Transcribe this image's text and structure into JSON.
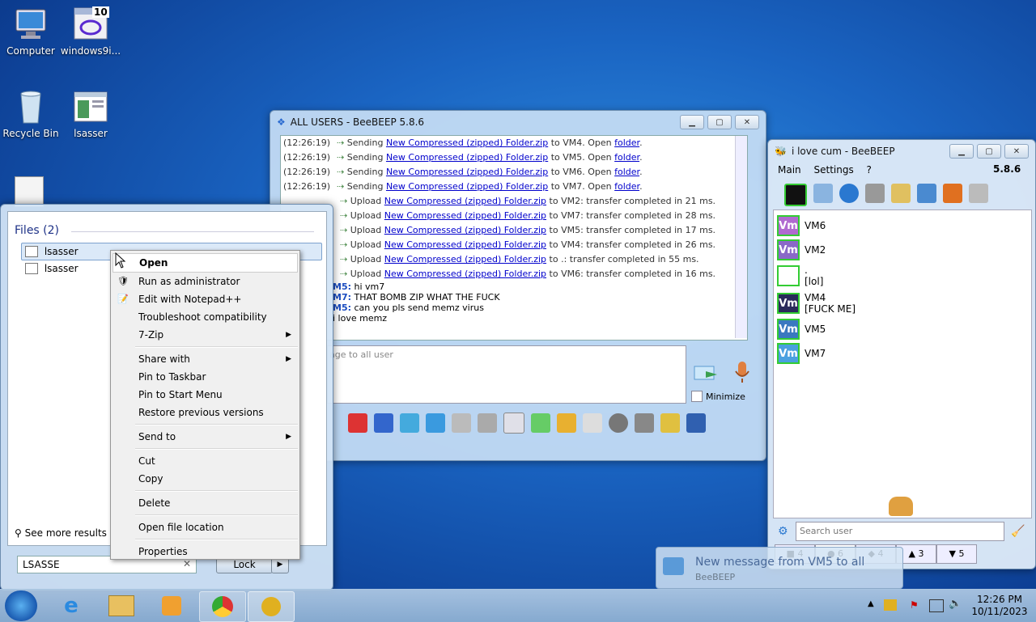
{
  "desktop": {
    "icons": [
      {
        "label": "Computer"
      },
      {
        "label": "windows9i..."
      },
      {
        "label": "Recycle Bin"
      },
      {
        "label": "lsasser"
      }
    ],
    "badge_10": "10"
  },
  "main_window": {
    "title": "ALL USERS - BeeBEEP 5.8.6",
    "log": [
      {
        "time": "(12:26:19)",
        "pre": "Sending ",
        "file": "New Compressed (zipped) Folder.zip",
        "mid": " to VM4. Open ",
        "link": "folder",
        "post": "."
      },
      {
        "time": "(12:26:19)",
        "pre": "Sending ",
        "file": "New Compressed (zipped) Folder.zip",
        "mid": " to VM5. Open ",
        "link": "folder",
        "post": "."
      },
      {
        "time": "(12:26:19)",
        "pre": "Sending ",
        "file": "New Compressed (zipped) Folder.zip",
        "mid": " to VM6. Open ",
        "link": "folder",
        "post": "."
      },
      {
        "time": "(12:26:19)",
        "pre": "Sending ",
        "file": "New Compressed (zipped) Folder.zip",
        "mid": " to VM7. Open ",
        "link": "folder",
        "post": "."
      },
      {
        "time": "",
        "pre": "Upload ",
        "file": "New Compressed (zipped) Folder.zip",
        "mid": " to VM2: transfer completed in 21 ms.",
        "link": "",
        "post": ""
      },
      {
        "time": "",
        "pre": "Upload ",
        "file": "New Compressed (zipped) Folder.zip",
        "mid": " to VM7: transfer completed in 28 ms.",
        "link": "",
        "post": ""
      },
      {
        "time": "",
        "pre": "Upload ",
        "file": "New Compressed (zipped) Folder.zip",
        "mid": " to VM5: transfer completed in 17 ms.",
        "link": "",
        "post": ""
      },
      {
        "time": "",
        "pre": "Upload ",
        "file": "New Compressed (zipped) Folder.zip",
        "mid": " to VM4: transfer completed in 26 ms.",
        "link": "",
        "post": ""
      },
      {
        "time": "",
        "pre": "Upload ",
        "file": "New Compressed (zipped) Folder.zip",
        "mid": " to .: transfer completed in 55 ms.",
        "link": "",
        "post": ""
      },
      {
        "time": "",
        "pre": "Upload ",
        "file": "New Compressed (zipped) Folder.zip",
        "mid": " to VM6: transfer completed in 16 ms.",
        "link": "",
        "post": ""
      }
    ],
    "chat": [
      {
        "who": "M5:",
        "msg": " hi vm7"
      },
      {
        "who": "M7:",
        "msg": " THAT BOMB ZIP WHAT THE FUCK"
      },
      {
        "who": "M5:",
        "msg": " can you pls send memz virus"
      },
      {
        "who": "",
        "msg": "i love memz"
      }
    ],
    "input_placeholder": "age to all user",
    "minimize_label": "Minimize"
  },
  "right_window": {
    "title": "i love cum - BeeBEEP",
    "menu": [
      "Main",
      "Settings",
      "?"
    ],
    "version": "5.8.6",
    "users": [
      {
        "avatar": "Vm",
        "name": "VM6",
        "status": "",
        "color": "#b06ad0"
      },
      {
        "avatar": "Vm",
        "name": "VM2",
        "status": "",
        "color": "#8a68c8"
      },
      {
        "avatar": "",
        "name": ".",
        "status": "[lol]",
        "color": "#ffffff"
      },
      {
        "avatar": "Vm",
        "name": "VM4",
        "status": "[FUCK ME]",
        "color": "#2a2a5a"
      },
      {
        "avatar": "Vm",
        "name": "VM5",
        "status": "",
        "color": "#3a78c0"
      },
      {
        "avatar": "Vm",
        "name": "VM7",
        "status": "",
        "color": "#4aa0e0"
      }
    ],
    "search_placeholder": "Search user",
    "tabs": [
      "4",
      "6",
      "4",
      "3",
      "5"
    ]
  },
  "notification": {
    "title": "New message from VM5 to all",
    "app": "BeeBEEP"
  },
  "start_menu": {
    "section": "Files (2)",
    "files": [
      "lsasser",
      "lsasser"
    ],
    "see_more": "See more results",
    "search_value": "LSASSE",
    "lock_label": "Lock"
  },
  "context_menu": {
    "groups": [
      [
        "Open",
        "Run as administrator",
        "Edit with Notepad++",
        "Troubleshoot compatibility",
        "7-Zip"
      ],
      [
        "Share with",
        "Pin to Taskbar",
        "Pin to Start Menu",
        "Restore previous versions"
      ],
      [
        "Send to"
      ],
      [
        "Cut",
        "Copy"
      ],
      [
        "Delete"
      ],
      [
        "Open file location"
      ],
      [
        "Properties"
      ]
    ]
  },
  "taskbar": {
    "time": "12:26 PM",
    "date": "10/11/2023"
  }
}
